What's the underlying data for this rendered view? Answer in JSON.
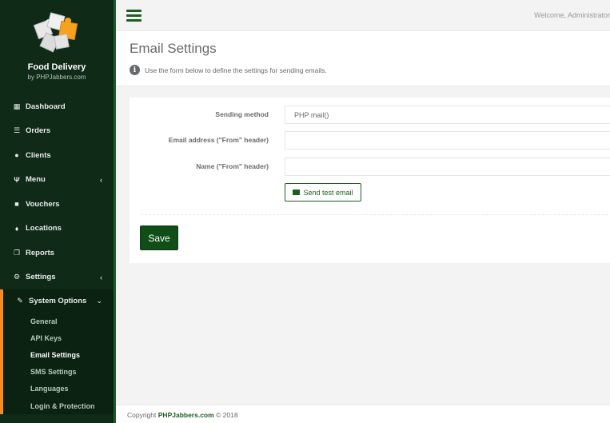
{
  "app": {
    "brand": "Food Delivery",
    "brand_sub": "by PHPJabbers.com"
  },
  "topbar": {
    "welcome": "Welcome, Administrator"
  },
  "sidebar": {
    "items": [
      {
        "label": "Dashboard",
        "icon": "dashboard-icon"
      },
      {
        "label": "Orders",
        "icon": "list-icon"
      },
      {
        "label": "Clients",
        "icon": "user-icon"
      },
      {
        "label": "Menu",
        "icon": "cutlery-icon"
      },
      {
        "label": "Vouchers",
        "icon": "gift-icon"
      },
      {
        "label": "Locations",
        "icon": "map-marker-icon"
      },
      {
        "label": "Reports",
        "icon": "copy-icon"
      },
      {
        "label": "Settings",
        "icon": "cogs-icon"
      },
      {
        "label": "System Options",
        "icon": "wrench-icon"
      }
    ],
    "sub_items": [
      {
        "label": "General"
      },
      {
        "label": "API Keys"
      },
      {
        "label": "Email Settings"
      },
      {
        "label": "SMS Settings"
      },
      {
        "label": "Languages"
      },
      {
        "label": "Login & Protection"
      }
    ]
  },
  "page": {
    "title": "Email Settings",
    "description": "Use the form below to define the settings for sending emails."
  },
  "form": {
    "sending_method_label": "Sending method",
    "sending_method_value": "PHP mail()",
    "email_label": "Email address (\"From\" header)",
    "email_value": "",
    "name_label": "Name (\"From\" header)",
    "name_value": "",
    "test_button": "Send test email",
    "save_button": "Save"
  },
  "footer": {
    "prefix": "Copyright",
    "company": "PHPJabbers.com",
    "year": "© 2018"
  },
  "colors": {
    "sidebar_bg": "#0f2a17",
    "accent_orange": "#f68b1f",
    "brand_green": "#1b5e20"
  }
}
